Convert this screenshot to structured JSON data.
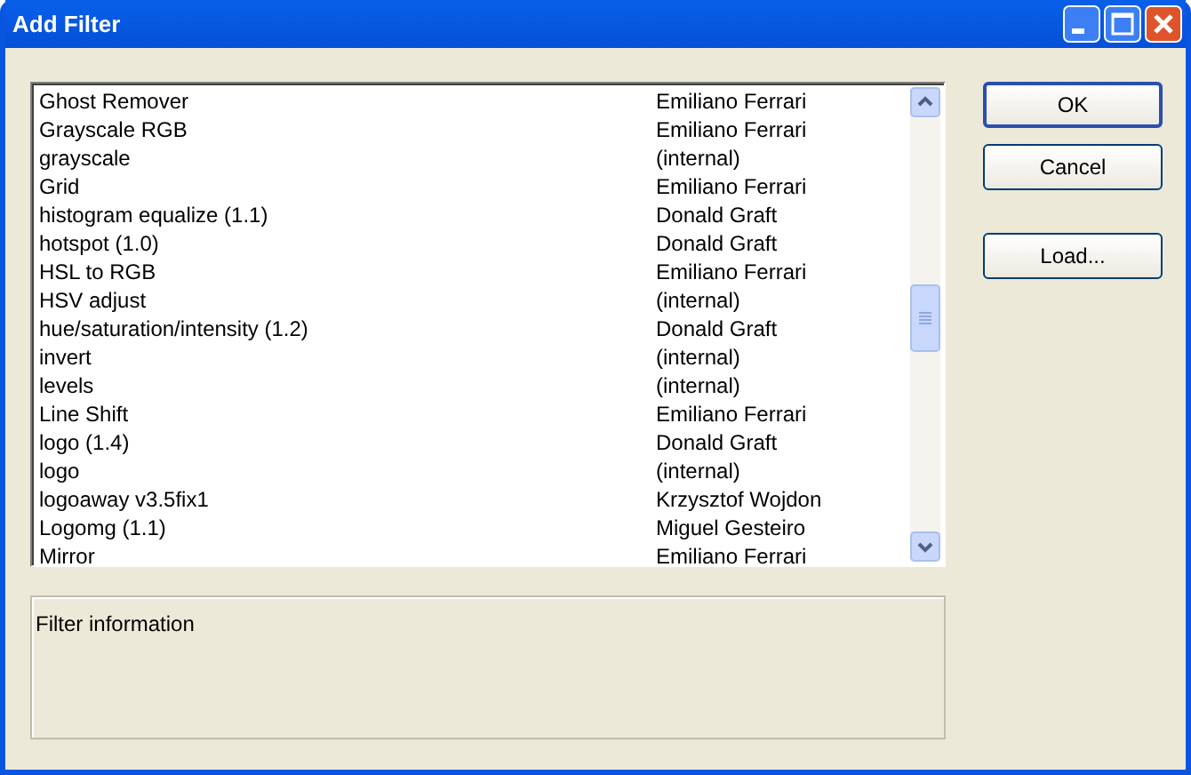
{
  "window": {
    "title": "Add Filter"
  },
  "filters": [
    {
      "name": "Ghost Remover",
      "author": "Emiliano Ferrari"
    },
    {
      "name": "Grayscale RGB",
      "author": "Emiliano Ferrari"
    },
    {
      "name": "grayscale",
      "author": "(internal)"
    },
    {
      "name": "Grid",
      "author": "Emiliano Ferrari"
    },
    {
      "name": "histogram equalize (1.1)",
      "author": "Donald Graft"
    },
    {
      "name": "hotspot (1.0)",
      "author": "Donald Graft"
    },
    {
      "name": "HSL to RGB",
      "author": "Emiliano Ferrari"
    },
    {
      "name": "HSV adjust",
      "author": "(internal)"
    },
    {
      "name": "hue/saturation/intensity (1.2)",
      "author": "Donald Graft"
    },
    {
      "name": "invert",
      "author": "(internal)"
    },
    {
      "name": "levels",
      "author": "(internal)"
    },
    {
      "name": "Line Shift",
      "author": "Emiliano Ferrari"
    },
    {
      "name": "logo (1.4)",
      "author": "Donald Graft"
    },
    {
      "name": "logo",
      "author": "(internal)"
    },
    {
      "name": "logoaway v3.5fix1",
      "author": "Krzysztof Wojdon"
    },
    {
      "name": "Logomg (1.1)",
      "author": "Miguel Gesteiro"
    },
    {
      "name": "Mirror",
      "author": "Emiliano Ferrari"
    }
  ],
  "info": {
    "label": "Filter information"
  },
  "buttons": [
    {
      "label": "OK",
      "default": true
    },
    {
      "label": "Cancel",
      "default": false
    },
    {
      "label": "Load..."
    }
  ]
}
